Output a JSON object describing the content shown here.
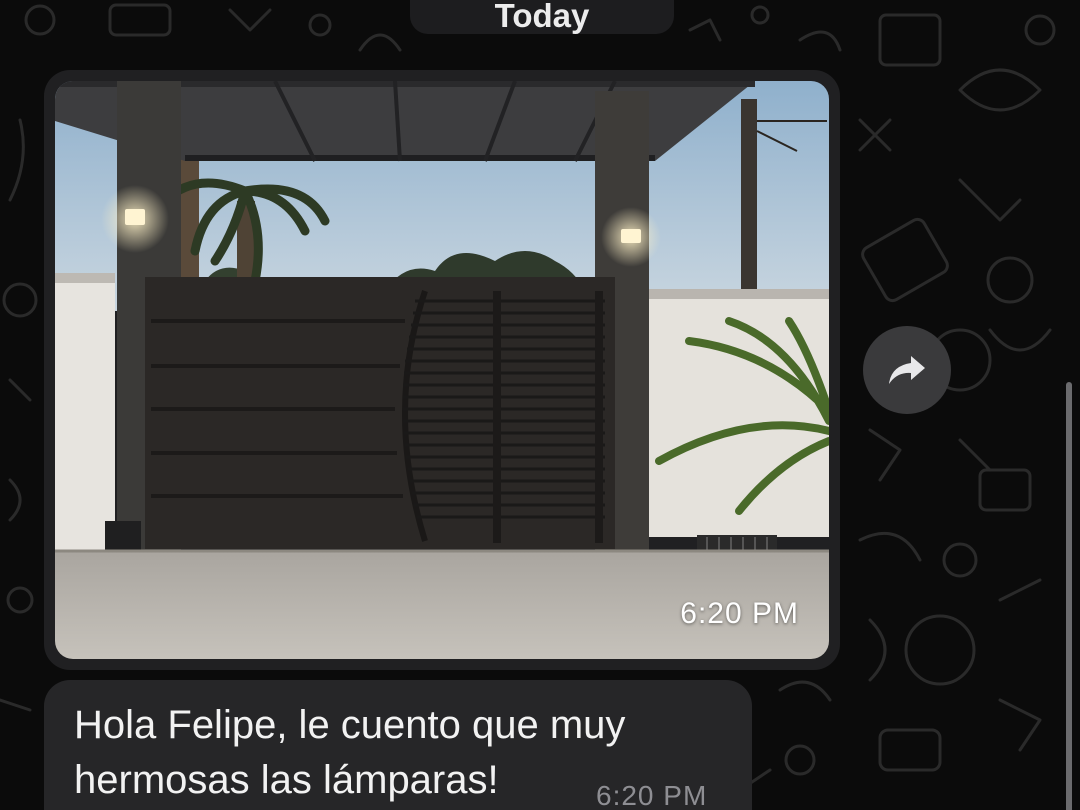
{
  "chat": {
    "date_separator": "Today",
    "image_message": {
      "time": "6:20 PM"
    },
    "text_message": {
      "text": "Hola Felipe, le cuento que muy hermosas las lámparas!",
      "time": "6:20 PM"
    },
    "forward_button_icon": "share-arrow-icon"
  },
  "colors": {
    "background": "#0b0b0b",
    "bubble": "#262628",
    "forward_button": "#3a3a3c",
    "text": "#f2f2f2",
    "timestamp": "#8e8e93"
  }
}
